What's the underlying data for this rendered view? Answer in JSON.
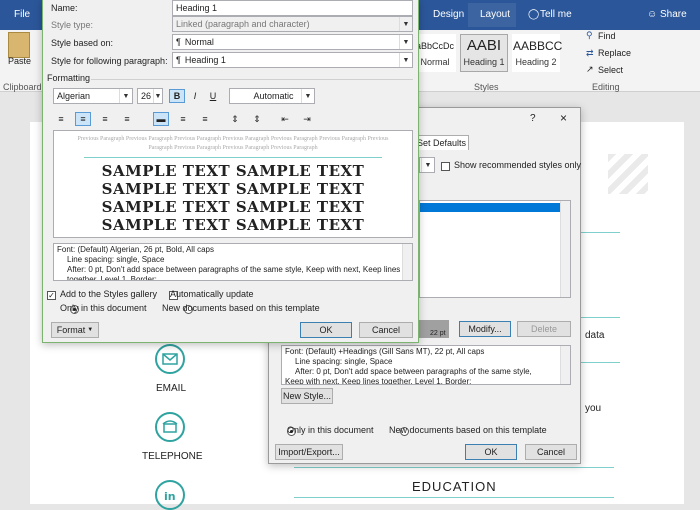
{
  "ribbon": {
    "tab_file": "File",
    "tab_design": "Design",
    "tab_layout": "Layout",
    "tell_me": "Tell me",
    "share": "Share",
    "paste": "Paste",
    "clipboard": "Clipboard",
    "styles_label": "Styles",
    "editing_label": "Editing",
    "find": "Find",
    "replace": "Replace",
    "select": "Select",
    "styles": [
      {
        "sample": "aBbCcDc",
        "name": "Normal"
      },
      {
        "sample": "AABI",
        "name": "Heading 1"
      },
      {
        "sample": "AABBCC",
        "name": "Heading 2"
      }
    ],
    "accent_color": "#2b579a"
  },
  "document": {
    "email": "EMAIL",
    "telephone": "TELEPHONE",
    "education": "EDUCATION",
    "data_fragment": "data",
    "you_fragment": "you",
    "accent_color": "#2fa3a0"
  },
  "modify_dialog": {
    "name_label": "Name:",
    "name_value": "Heading 1",
    "style_type_label": "Style type:",
    "style_type_value": "Linked (paragraph and character)",
    "based_on_label": "Style based on:",
    "based_on_value": "Normal",
    "following_label": "Style for following paragraph:",
    "following_value": "Heading 1",
    "formatting_label": "Formatting",
    "font_value": "Algerian",
    "size_value": "26",
    "bold": "B",
    "italic": "I",
    "underline": "U",
    "color_value": "Automatic",
    "preview_previous": "Previous Paragraph Previous Paragraph Previous Paragraph Previous Paragraph Previous Paragraph Previous Paragraph Previous Paragraph Previous Paragraph Previous Paragraph Previous Paragraph",
    "sample_lines": [
      "SAMPLE TEXT SAMPLE TEXT",
      "SAMPLE TEXT SAMPLE TEXT",
      "SAMPLE TEXT SAMPLE TEXT",
      "SAMPLE TEXT SAMPLE TEXT"
    ],
    "description_lines": [
      "Font: (Default) Algerian, 26 pt, Bold, All caps",
      "Line spacing:  single, Space",
      "After:  0 pt, Don't add space between paragraphs of the same style, Keep with next, Keep lines together, Level 1, Border:"
    ],
    "add_gallery": "Add to the Styles gallery",
    "auto_update": "Automatically update",
    "only_doc": "Only in this document",
    "new_docs": "New documents based on this template",
    "format_btn": "Format",
    "ok": "OK",
    "cancel": "Cancel"
  },
  "manage_dialog": {
    "help": "?",
    "close": "×",
    "tab_set_defaults": "Set Defaults",
    "show_recommended": "Show recommended styles only",
    "preview_size": "22 pt",
    "modify_btn": "Modify...",
    "delete_btn": "Delete",
    "description_lines": [
      "Font: (Default) +Headings (Gill Sans MT), 22 pt, All caps",
      "Line spacing:  single, Space",
      "After:  0 pt, Don't add space between paragraphs of the same style,",
      "Keep with next, Keep lines together, Level 1, Border:"
    ],
    "new_style_btn": "New Style...",
    "only_doc": "Only in this document",
    "new_docs": "New documents based on this template",
    "import_export": "Import/Export...",
    "ok": "OK",
    "cancel": "Cancel"
  }
}
